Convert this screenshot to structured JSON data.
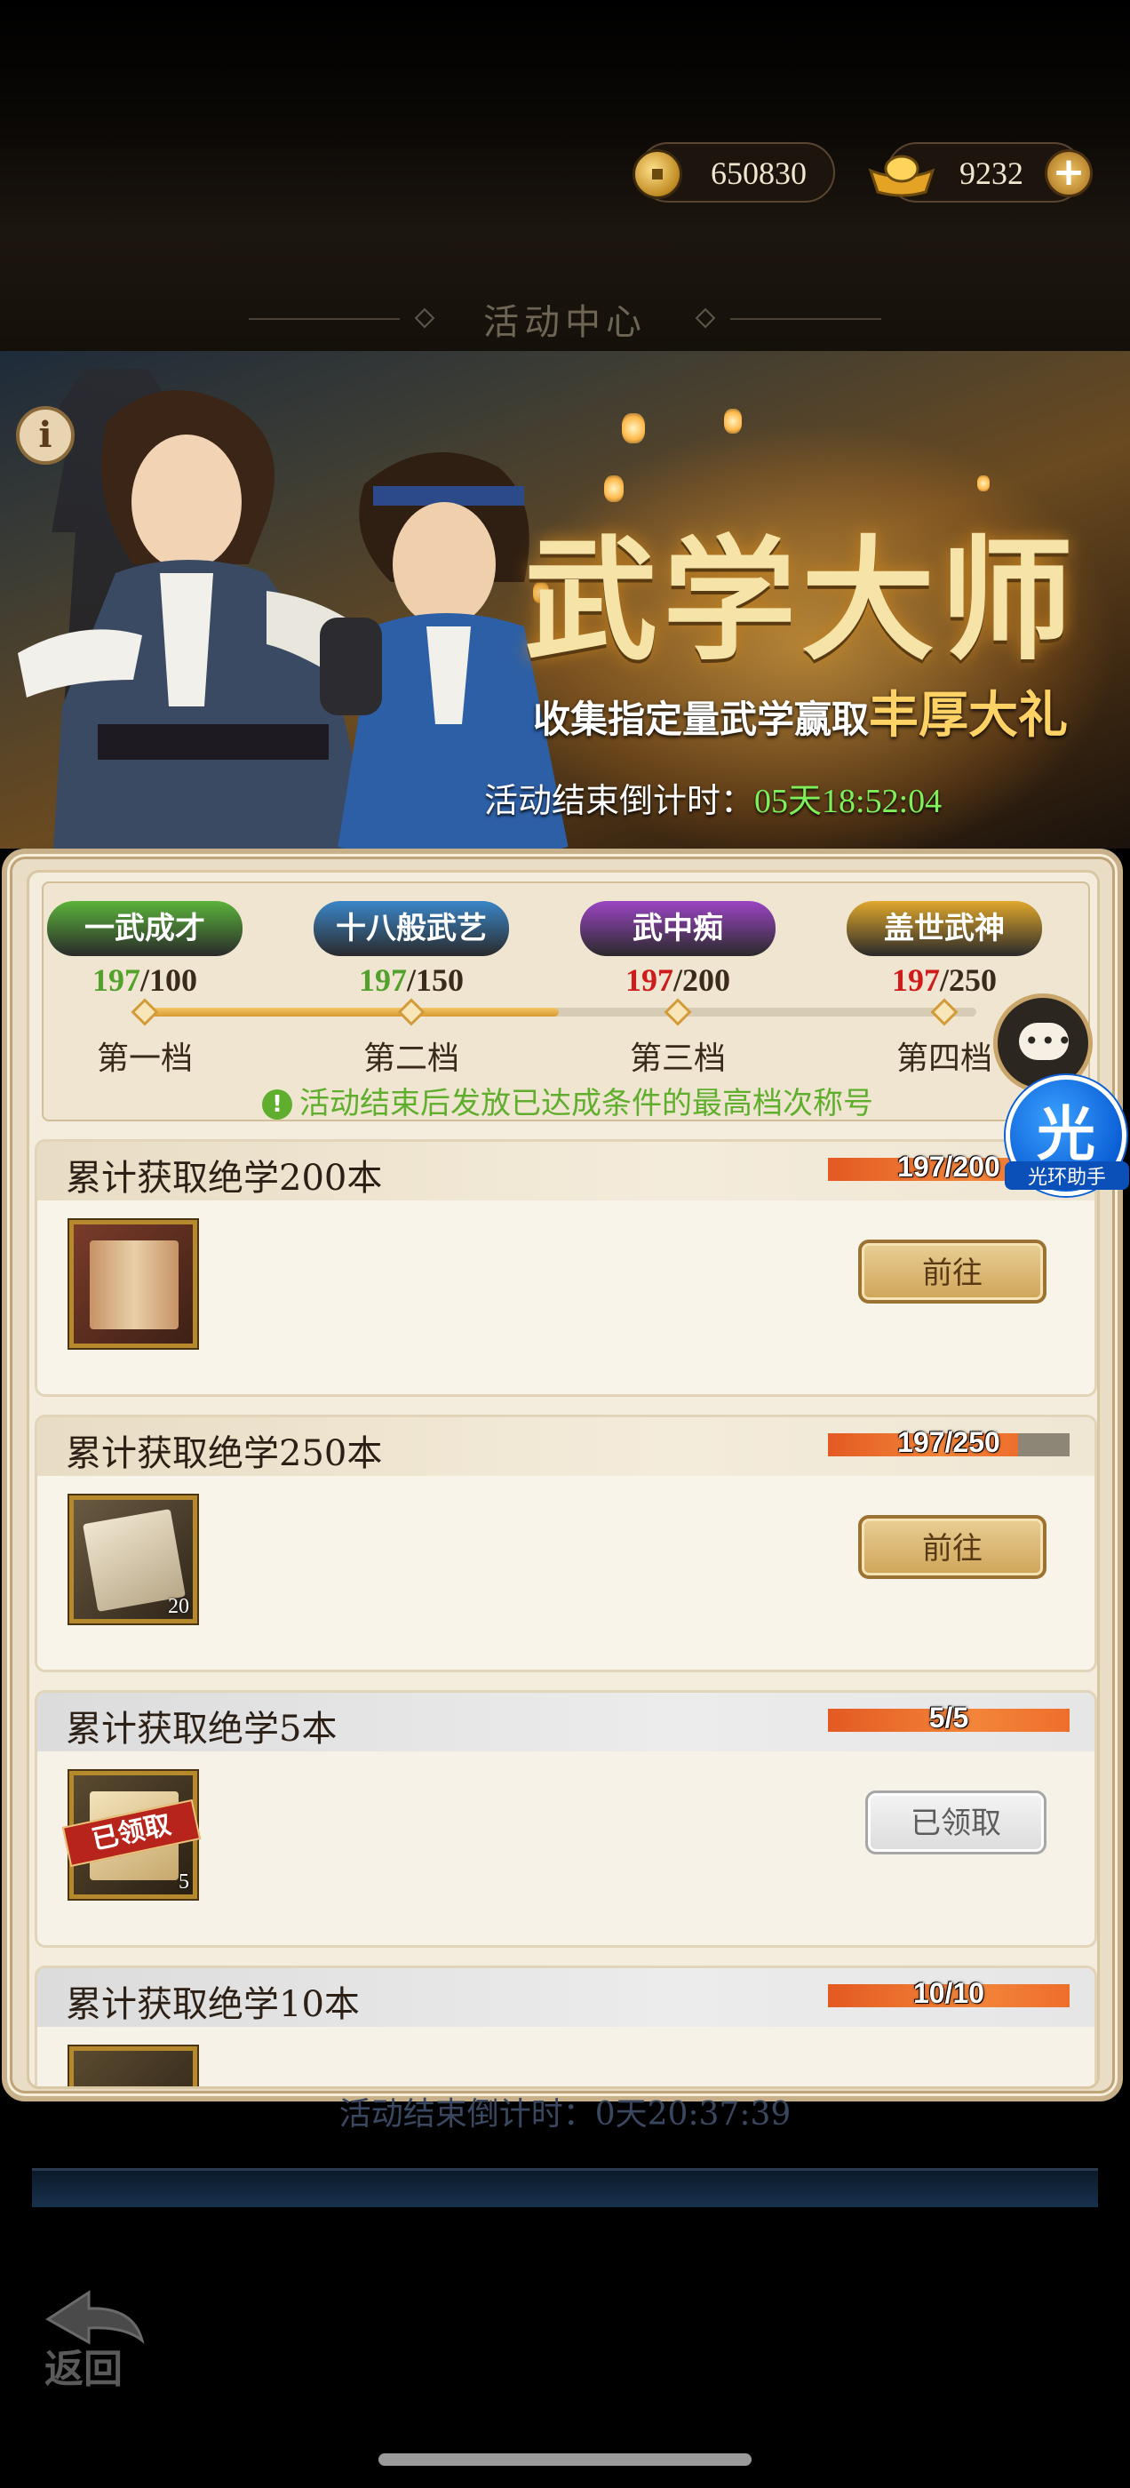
{
  "currency": {
    "coins": "650830",
    "ingots": "9232",
    "coin_icon": "coin-icon",
    "ingot_icon": "gold-ingot-icon",
    "add_icon": "plus-icon"
  },
  "header": {
    "title": "活动中心"
  },
  "banner": {
    "title": "武学大师",
    "subtitle_prefix": "收集指定量武学赢取",
    "subtitle_highlight": "丰厚大礼",
    "countdown_label": "活动结束倒计时：",
    "countdown_value": "05天18:52:04",
    "info_icon": "i"
  },
  "tiers": {
    "items": [
      {
        "badge": "一武成才",
        "current": "197",
        "target": "/100",
        "name": "第一档",
        "reached": true,
        "color": "#5bb33a"
      },
      {
        "badge": "十八般武艺",
        "current": "197",
        "target": "/150",
        "name": "第二档",
        "reached": true,
        "color": "#3a86c8"
      },
      {
        "badge": "武中痴",
        "current": "197",
        "target": "/200",
        "name": "第三档",
        "reached": false,
        "color": "#9b45c4"
      },
      {
        "badge": "盖世武神",
        "current": "197",
        "target": "/250",
        "name": "第四档",
        "reached": false,
        "color": "#e0a72c"
      }
    ],
    "progress_fraction": 0.5,
    "notice": "活动结束后发放已达成条件的最高档次称号",
    "notice_icon": "!"
  },
  "tasks": [
    {
      "title": "累计获取绝学200本",
      "progress_text": "197/200",
      "progress": 0.985,
      "item_qty": "",
      "button": "前往",
      "done": false
    },
    {
      "title": "累计获取绝学250本",
      "progress_text": "197/250",
      "progress": 0.788,
      "item_qty": "20",
      "button": "前往",
      "done": false
    },
    {
      "title": "累计获取绝学5本",
      "progress_text": "5/5",
      "progress": 1.0,
      "item_qty": "5",
      "button": "已领取",
      "stamp": "已领取",
      "done": true
    },
    {
      "title": "累计获取绝学10本",
      "progress_text": "10/10",
      "progress": 1.0,
      "item_qty": "",
      "button": "",
      "done": true
    }
  ],
  "below": {
    "countdown": "活动结束倒计时：0天20:37:39"
  },
  "nav": {
    "back_label": "返回"
  },
  "floating": {
    "assistant_char": "光",
    "assistant_label": "光环助手"
  },
  "colors": {
    "accent_gold": "#d39a3a",
    "progress_orange": "#ee6e2c",
    "notice_green": "#5fae2d",
    "miss_red": "#d01b1b"
  }
}
